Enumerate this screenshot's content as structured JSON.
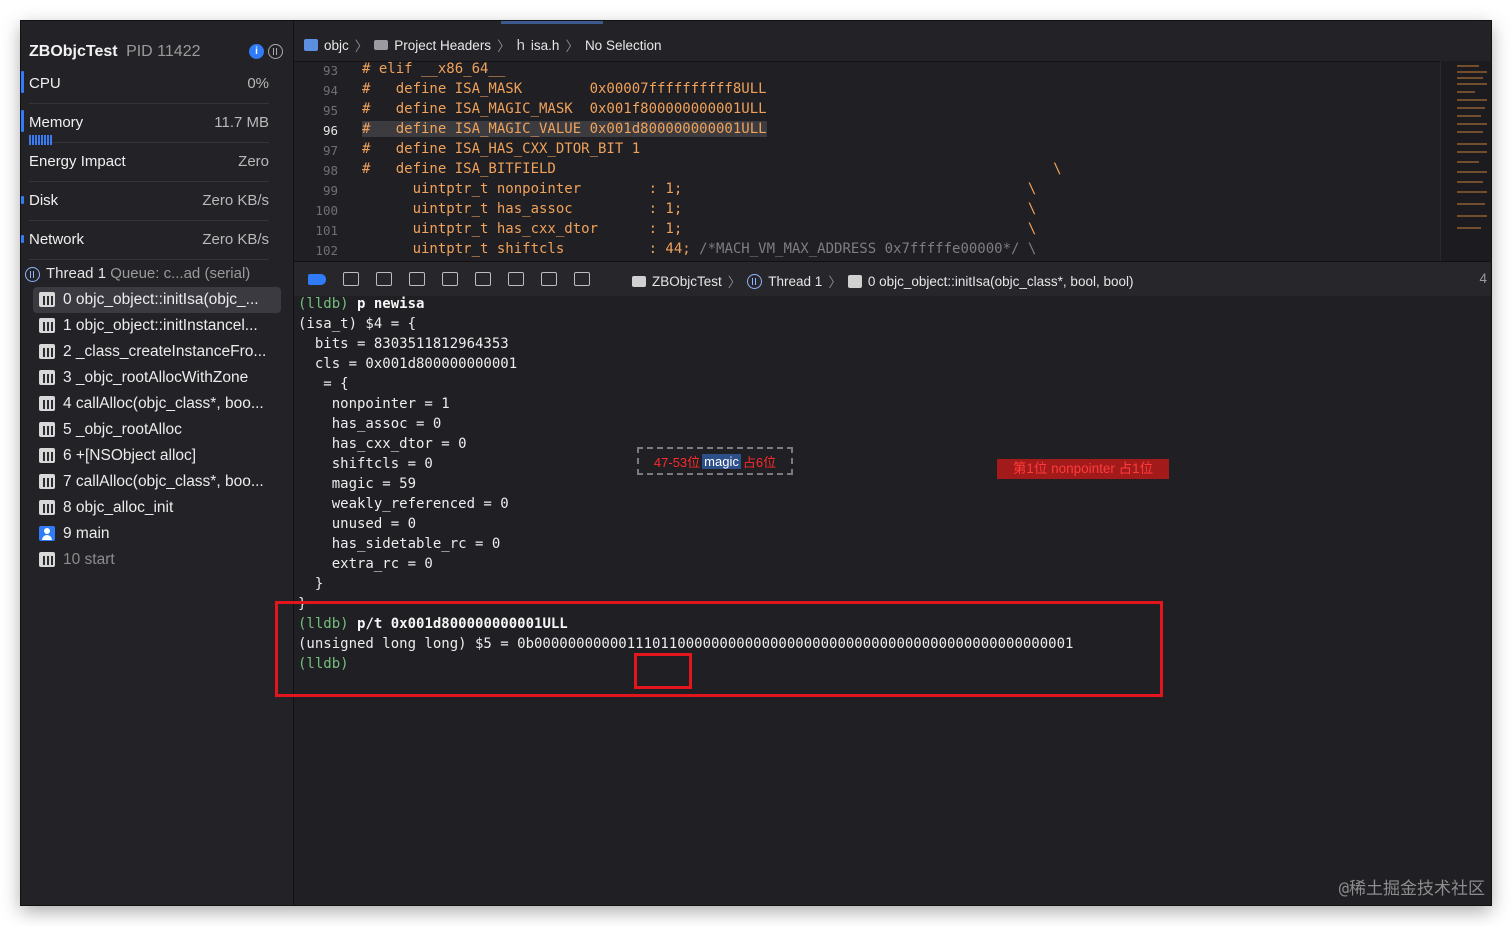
{
  "sidebar": {
    "app_name": "ZBObjcTest",
    "pid": "PID 11422",
    "gauges": [
      {
        "label": "CPU",
        "value": "0%"
      },
      {
        "label": "Memory",
        "value": "11.7 MB"
      },
      {
        "label": "Energy Impact",
        "value": "Zero"
      },
      {
        "label": "Disk",
        "value": "Zero KB/s"
      },
      {
        "label": "Network",
        "value": "Zero KB/s"
      }
    ],
    "thread": {
      "label": "Thread 1",
      "queue": "Queue: c...ad (serial)"
    },
    "frames": [
      {
        "label": "0 objc_object::initIsa(objc_...",
        "icon": "framework-icon"
      },
      {
        "label": "1 objc_object::initInstancel...",
        "icon": "framework-icon"
      },
      {
        "label": "2 _class_createInstanceFro...",
        "icon": "framework-icon"
      },
      {
        "label": "3 _objc_rootAllocWithZone",
        "icon": "framework-icon"
      },
      {
        "label": "4 callAlloc(objc_class*, boo...",
        "icon": "framework-icon"
      },
      {
        "label": "5 _objc_rootAlloc",
        "icon": "framework-icon"
      },
      {
        "label": "6 +[NSObject alloc]",
        "icon": "framework-icon"
      },
      {
        "label": "7 callAlloc(objc_class*, boo...",
        "icon": "framework-icon"
      },
      {
        "label": "8 objc_alloc_init",
        "icon": "framework-icon"
      },
      {
        "label": "9 main",
        "icon": "user-code-icon"
      },
      {
        "label": "10 start",
        "icon": "framework-icon"
      }
    ]
  },
  "jumpbar": {
    "items": [
      "objc",
      "Project Headers",
      "h",
      "isa.h",
      "No Selection"
    ]
  },
  "code_lines": [
    {
      "n": "93",
      "code": "# elif __x86_64__"
    },
    {
      "n": "94",
      "code": "#   define ISA_MASK        0x00007ffffffffff8ULL"
    },
    {
      "n": "95",
      "code": "#   define ISA_MAGIC_MASK  0x001f800000000001ULL"
    },
    {
      "n": "96",
      "code": "#   define ISA_MAGIC_VALUE 0x001d800000000001ULL"
    },
    {
      "n": "97",
      "code": "#   define ISA_HAS_CXX_DTOR_BIT 1"
    },
    {
      "n": "98",
      "code": "#   define ISA_BITFIELD                                                           \\"
    },
    {
      "n": "99",
      "code": "      uintptr_t nonpointer        : 1;                                         \\"
    },
    {
      "n": "100",
      "code": "      uintptr_t has_assoc         : 1;                                         \\"
    },
    {
      "n": "101",
      "code": "      uintptr_t has_cxx_dtor      : 1;                                         \\"
    },
    {
      "n": "102",
      "code": "      uintptr_t shiftcls          : 44; "
    },
    {
      "n": "102c",
      "code": "/*MACH_VM_MAX_ADDRESS 0x7fffffe00000*/ \\"
    }
  ],
  "debugbar": {
    "trail": [
      "ZBObjcTest",
      "Thread 1",
      "0 objc_object::initIsa(objc_class*, bool, bool)"
    ],
    "page": "4"
  },
  "console": {
    "lines": [
      {
        "prompt": "(lldb) ",
        "cmd": "p newisa",
        "text": ""
      },
      {
        "prompt": "",
        "cmd": "",
        "text": "(isa_t) $4 = {"
      },
      {
        "prompt": "",
        "cmd": "",
        "text": "  bits = 8303511812964353"
      },
      {
        "prompt": "",
        "cmd": "",
        "text": "  cls = 0x001d800000000001"
      },
      {
        "prompt": "",
        "cmd": "",
        "text": "   = {"
      },
      {
        "prompt": "",
        "cmd": "",
        "text": "    nonpointer = 1"
      },
      {
        "prompt": "",
        "cmd": "",
        "text": "    has_assoc = 0"
      },
      {
        "prompt": "",
        "cmd": "",
        "text": "    has_cxx_dtor = 0"
      },
      {
        "prompt": "",
        "cmd": "",
        "text": "    shiftcls = 0"
      },
      {
        "prompt": "",
        "cmd": "",
        "text": "    magic = 59"
      },
      {
        "prompt": "",
        "cmd": "",
        "text": "    weakly_referenced = 0"
      },
      {
        "prompt": "",
        "cmd": "",
        "text": "    unused = 0"
      },
      {
        "prompt": "",
        "cmd": "",
        "text": "    has_sidetable_rc = 0"
      },
      {
        "prompt": "",
        "cmd": "",
        "text": "    extra_rc = 0"
      },
      {
        "prompt": "",
        "cmd": "",
        "text": "  }"
      },
      {
        "prompt": "",
        "cmd": "",
        "text": "}"
      },
      {
        "prompt": "(lldb) ",
        "cmd": "p/t 0x001d800000000001ULL",
        "text": ""
      },
      {
        "prompt": "",
        "cmd": "",
        "text": "(unsigned long long) $5 = 0b0000000000011101100000000000000000000000000000000000000000000001"
      },
      {
        "prompt": "(lldb)",
        "cmd": "",
        "text": ""
      }
    ]
  },
  "annotations": {
    "magic_prefix": "47-53位",
    "magic_word": "magic",
    "magic_suffix": "占6位",
    "nonpointer": "第1位 nonpointer 占1位"
  },
  "watermark": "@稀土掘金技术社区",
  "colors": {
    "accent": "#2f7cf6",
    "annotation_red": "#e3151d",
    "code_orange": "#f0a25a",
    "prompt_green": "#74c07a"
  }
}
